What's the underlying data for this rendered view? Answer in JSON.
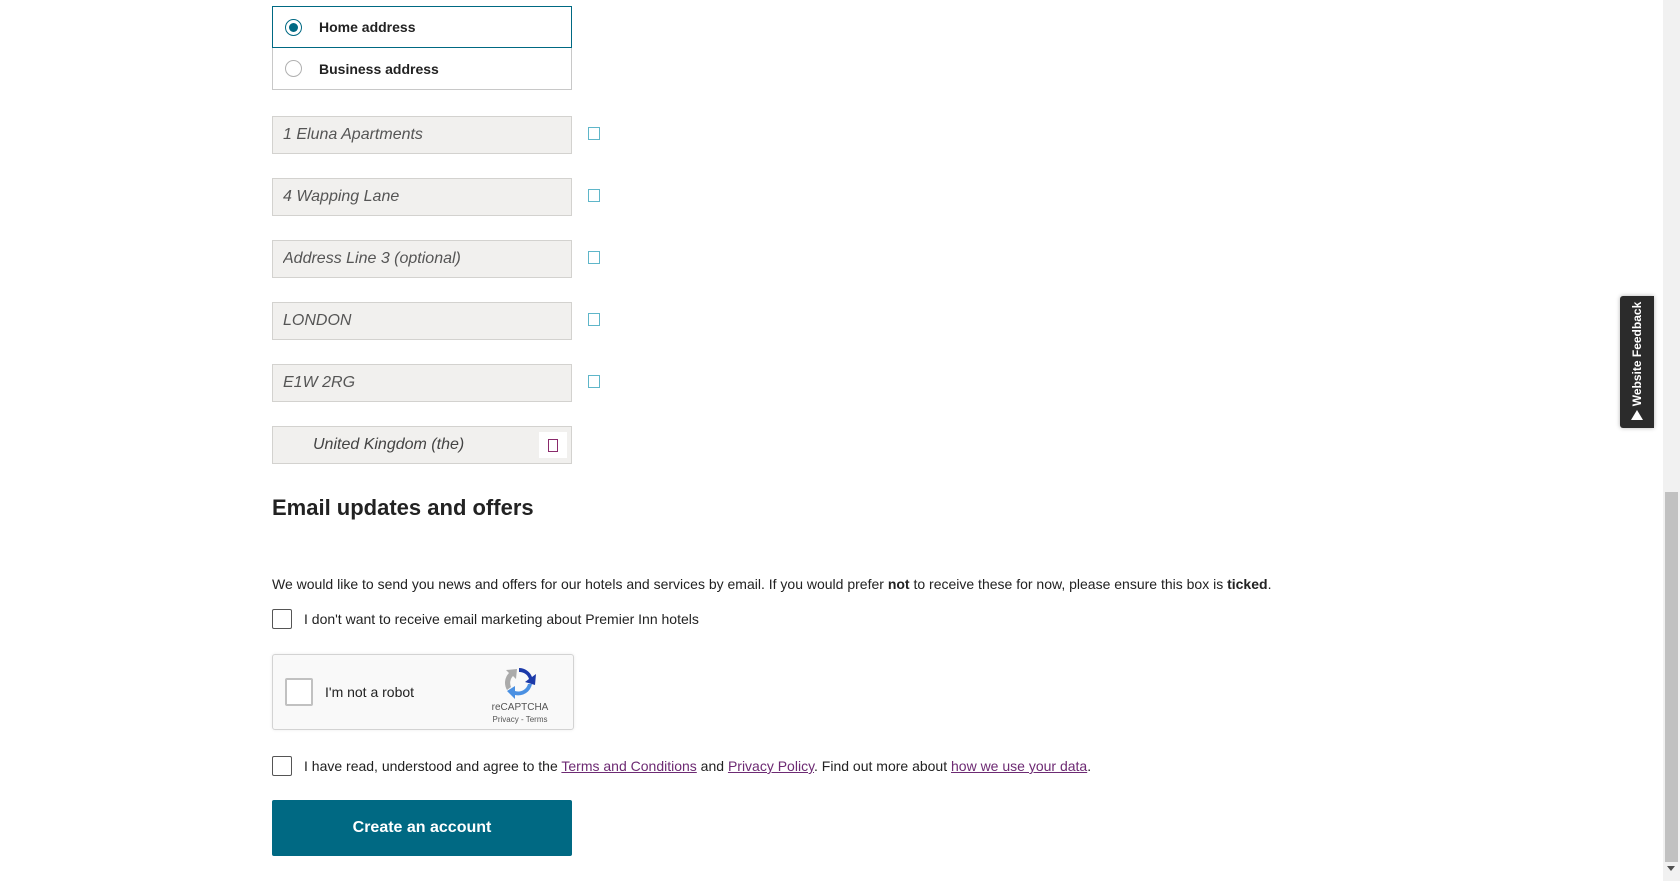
{
  "address_type": {
    "options": [
      {
        "label": "Home address",
        "selected": true
      },
      {
        "label": "Business address",
        "selected": false
      }
    ]
  },
  "address_fields": [
    {
      "value": "1 Eluna Apartments"
    },
    {
      "value": "4 Wapping Lane"
    },
    {
      "placeholder": "Address Line 3 (optional)"
    },
    {
      "value": "LONDON"
    },
    {
      "value": "E1W 2RG"
    }
  ],
  "country": {
    "selected": "United Kingdom (the)"
  },
  "email_section": {
    "title": "Email updates and offers",
    "intro_pre": "We would like to send you news and offers for our hotels and services by email. If you would prefer ",
    "intro_not": "not",
    "intro_mid": " to receive these for now, please ensure this box is ",
    "intro_ticked": "ticked",
    "intro_end": ".",
    "opt_out_label": "I don't want to receive email marketing about Premier Inn hotels"
  },
  "recaptcha": {
    "label": "I'm not a robot",
    "brand": "reCAPTCHA",
    "terms": "Privacy - Terms"
  },
  "terms": {
    "pre": "I have read, understood and agree to the ",
    "terms_link": "Terms and Conditions",
    "and": " and ",
    "privacy_link": "Privacy Policy",
    "mid": ". Find out more about ",
    "data_link": "how we use your data",
    "end": "."
  },
  "cta": {
    "label": "Create an account"
  },
  "feedback": {
    "label": "Website Feedback"
  },
  "colors": {
    "brand": "#006983",
    "link": "#6d2a73",
    "field_bg": "#f1f0ee"
  }
}
